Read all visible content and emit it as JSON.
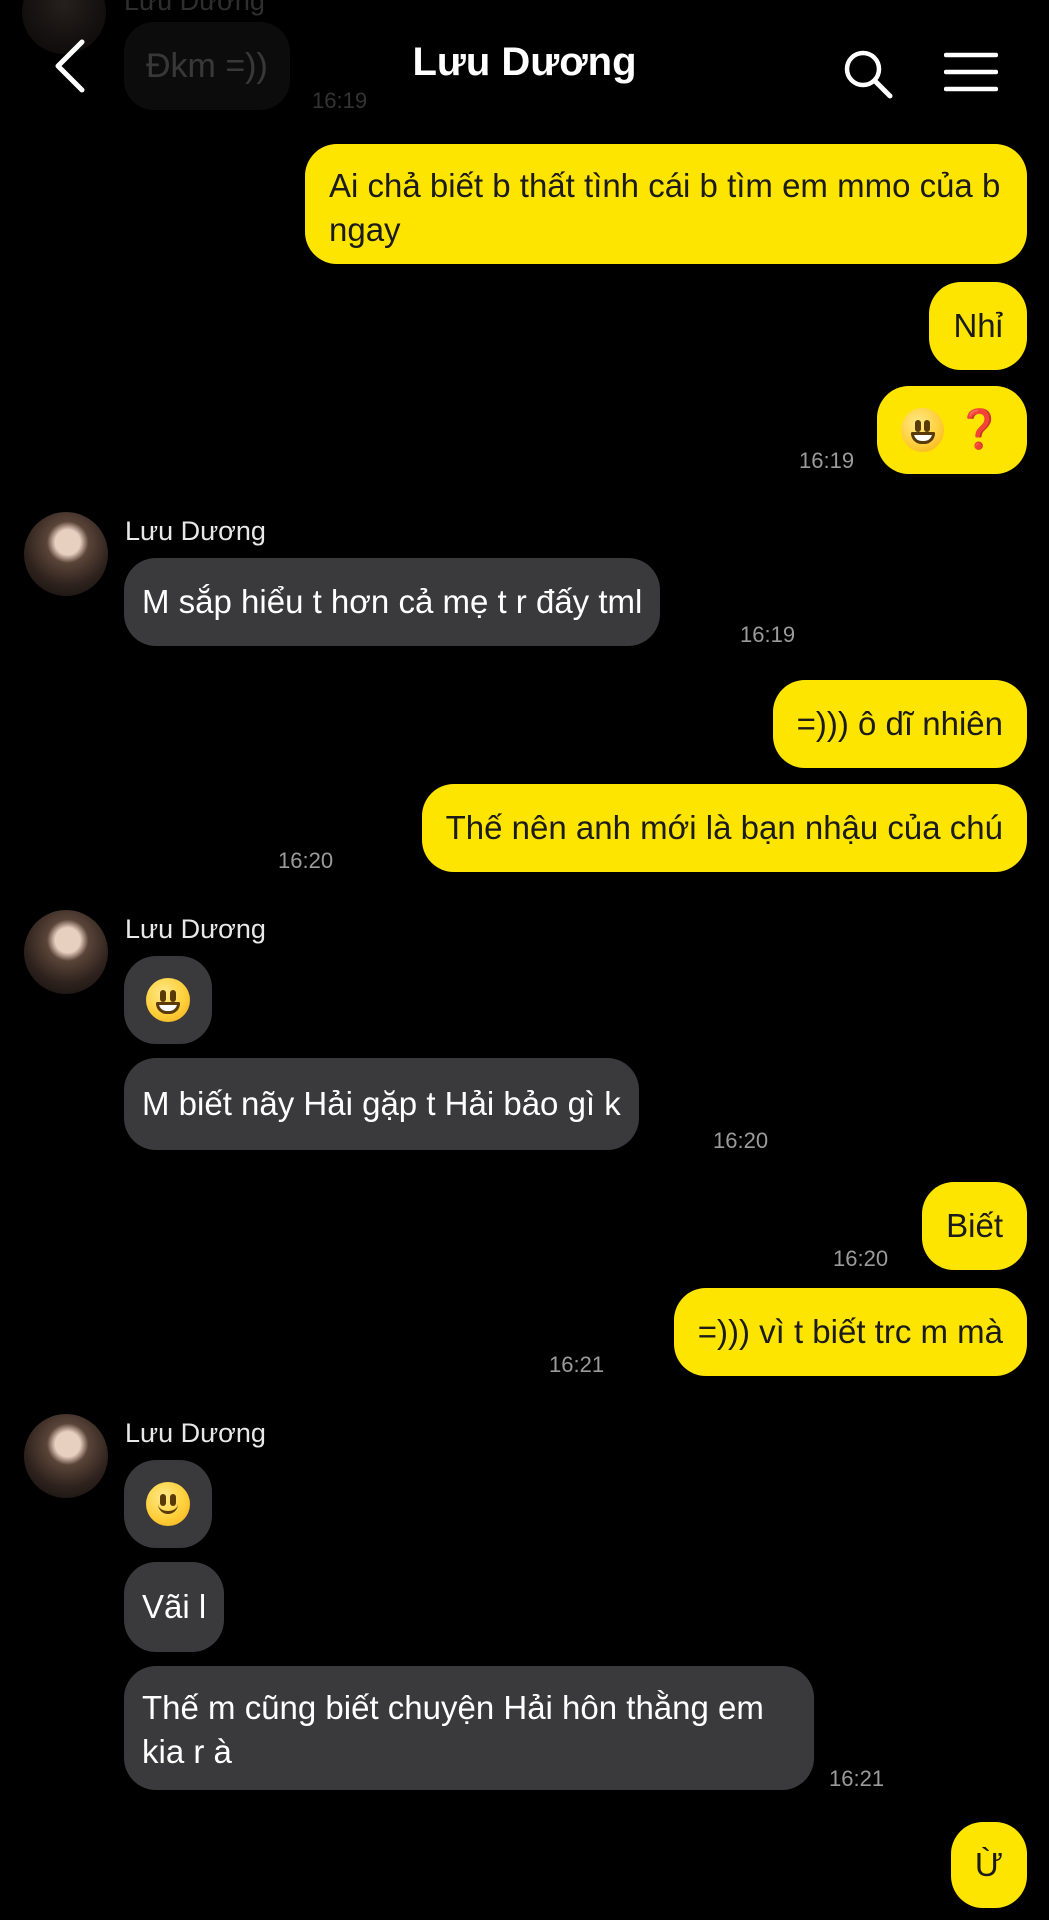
{
  "header": {
    "title": "Lưu Dương",
    "ghost_name": "Lưu Dương",
    "ghost_message": "Đkm =))",
    "ghost_time": "16:19"
  },
  "messages": [
    {
      "side": "mine",
      "text": "Ai chả biết b thất tình cái b tìm em mmo của b ngay"
    },
    {
      "side": "mine",
      "text": "Nhỉ"
    },
    {
      "side": "mine",
      "emoji": "grinning-face",
      "extra": "❓",
      "time": "16:19"
    },
    {
      "side": "theirs",
      "sender": "Lưu Dương",
      "text": "M sắp hiểu t hơn cả mẹ t r đấy tml",
      "time": "16:19"
    },
    {
      "side": "mine",
      "text": "=))) ô dĩ nhiên"
    },
    {
      "side": "mine",
      "text": "Thế nên anh mới là bạn nhậu của chú",
      "time": "16:20"
    },
    {
      "side": "theirs",
      "sender": "Lưu Dương",
      "emoji": "grinning-face"
    },
    {
      "side": "theirs",
      "text": "M biết nãy Hải gặp t Hải bảo gì k",
      "time": "16:20"
    },
    {
      "side": "mine",
      "text": "Biết",
      "time": "16:20"
    },
    {
      "side": "mine",
      "text": "=))) vì t biết trc m mà",
      "time": "16:21"
    },
    {
      "side": "theirs",
      "sender": "Lưu Dương",
      "emoji": "slightly-smiling-face"
    },
    {
      "side": "theirs",
      "text": "Vãi l"
    },
    {
      "side": "theirs",
      "text": "Thế m cũng biết chuyện Hải hôn thằng em kia r à",
      "time": "16:21"
    },
    {
      "side": "mine",
      "text": "Ừ"
    }
  ],
  "colors": {
    "mine_bubble": "#fee500",
    "theirs_bubble": "#3a3a3c",
    "background": "#000000"
  },
  "icons": {
    "back": "chevron-left-icon",
    "search": "search-icon",
    "menu": "hamburger-menu-icon"
  }
}
